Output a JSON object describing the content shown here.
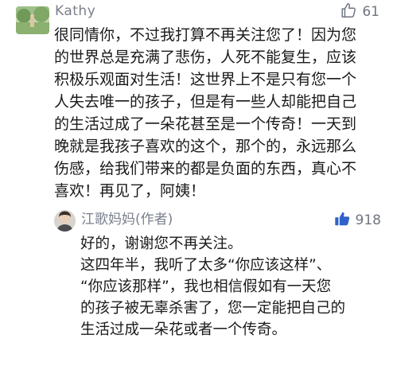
{
  "comment": {
    "username": "Kathy",
    "likes": "61",
    "like_icon": "thumbs-up-outline-icon",
    "lines": [
      "很同情你，不过我打算不再关注您了！因为您",
      "的世界总是充满了悲伤，人死不能复生，应该",
      "积极乐观面对生活！这世界上不是只有您一个",
      "人失去唯一的孩子，但是有一些人却能把自己",
      "的生活过成了一朵花甚至是一个传奇！一天到",
      "晚就是我孩子喜欢的这个，那个的，永远那么",
      "伤感，给我们带来的都是负面的东西，真心不",
      "喜欢！再见了，阿姨！"
    ]
  },
  "reply": {
    "username": "江歌妈妈(作者)",
    "likes": "918",
    "like_icon": "thumbs-up-filled-icon",
    "accent_color": "#2f62c9",
    "lines": [
      "好的，谢谢您不再关注。",
      "这四年半，我听了太多“你应该这样”、",
      "“你应该那样”，我也相信假如有一天您",
      "的孩子被无辜杀害了，您一定能把自己的",
      "生活过成一朵花或者一个传奇。"
    ]
  }
}
